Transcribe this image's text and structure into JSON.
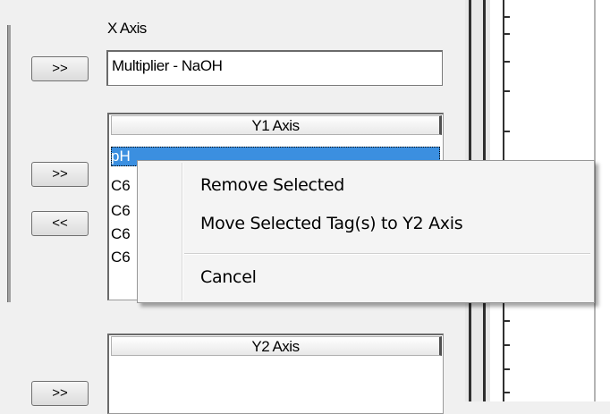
{
  "x_axis": {
    "label": "X Axis",
    "add_button": ">>",
    "value": "Multiplier - NaOH"
  },
  "y1_axis": {
    "add_button": ">>",
    "remove_button": "<<",
    "header": "Y1 Axis",
    "items": [
      "pH",
      "C6",
      "C6",
      "C6",
      "C6"
    ]
  },
  "y2_axis": {
    "add_button": ">>",
    "header": "Y2 Axis"
  },
  "context_menu": {
    "items": [
      "Remove Selected",
      "Move Selected Tag(s) to Y2 Axis",
      "Cancel"
    ]
  }
}
